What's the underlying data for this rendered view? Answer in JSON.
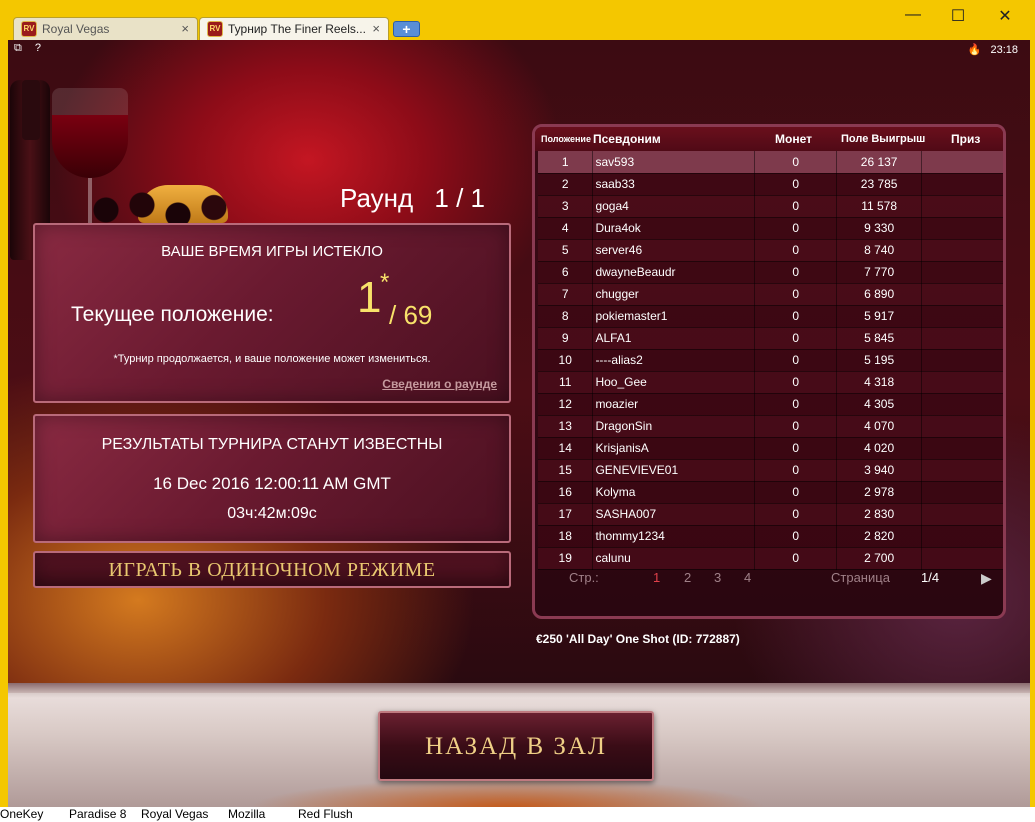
{
  "browser": {
    "tabs": [
      {
        "label": "Royal Vegas",
        "active": false
      },
      {
        "label": "Турнир The Finer Reels...",
        "active": true
      }
    ],
    "tab_icon": "RV",
    "tab_close": "×",
    "new_tab": "+",
    "window_controls": {
      "minimize": "—",
      "maximize": "☐",
      "close": "✕"
    }
  },
  "game_header": {
    "icons": [
      "copy-icon",
      "help-icon"
    ],
    "copy_glyph": "⧉",
    "help_glyph": "?",
    "time": "23:18",
    "flame_glyph": "🔥"
  },
  "round": {
    "label": "Раунд",
    "value": "1 / 1"
  },
  "status_panel": {
    "title": "ВАШЕ ВРЕМЯ ИГРЫ ИСТЕКЛО",
    "position_label": "Текущее положение:",
    "position": "1",
    "position_star": "*",
    "position_total": "/ 69",
    "note": "*Турнир продолжается, и ваше положение может измениться.",
    "details_link": "Сведения о раунде"
  },
  "results_panel": {
    "title": "РЕЗУЛЬТАТЫ ТУРНИРА СТАНУТ ИЗВЕСТНЫ",
    "date": "16 Dec 2016 12:00:11 AM GMT",
    "countdown": "03ч:42м:09с"
  },
  "play_single_button": "ИГРАТЬ В ОДИНОЧНОМ РЕЖИМЕ",
  "leaderboard": {
    "headers": {
      "position": "Положение",
      "nickname": "Псевдоним",
      "coins": "Монет",
      "winnings": "Поле Выигрыш",
      "prize": "Приз"
    },
    "rows": [
      {
        "pos": "1",
        "name": "sav593",
        "coins": "0",
        "win": "26 137",
        "prize": ""
      },
      {
        "pos": "2",
        "name": "saab33",
        "coins": "0",
        "win": "23 785",
        "prize": ""
      },
      {
        "pos": "3",
        "name": "goga4",
        "coins": "0",
        "win": "11 578",
        "prize": ""
      },
      {
        "pos": "4",
        "name": "Dura4ok",
        "coins": "0",
        "win": "9 330",
        "prize": ""
      },
      {
        "pos": "5",
        "name": "server46",
        "coins": "0",
        "win": "8 740",
        "prize": ""
      },
      {
        "pos": "6",
        "name": "dwayneBeaudr",
        "coins": "0",
        "win": "7 770",
        "prize": ""
      },
      {
        "pos": "7",
        "name": "chugger",
        "coins": "0",
        "win": "6 890",
        "prize": ""
      },
      {
        "pos": "8",
        "name": "pokiemaster1",
        "coins": "0",
        "win": "5 917",
        "prize": ""
      },
      {
        "pos": "9",
        "name": "ALFA1",
        "coins": "0",
        "win": "5 845",
        "prize": ""
      },
      {
        "pos": "10",
        "name": "----alias2",
        "coins": "0",
        "win": "5 195",
        "prize": ""
      },
      {
        "pos": "11",
        "name": "Hoo_Gee",
        "coins": "0",
        "win": "4 318",
        "prize": ""
      },
      {
        "pos": "12",
        "name": "moazier",
        "coins": "0",
        "win": "4 305",
        "prize": ""
      },
      {
        "pos": "13",
        "name": "DragonSin",
        "coins": "0",
        "win": "4 070",
        "prize": ""
      },
      {
        "pos": "14",
        "name": "KrisjanisA",
        "coins": "0",
        "win": "4 020",
        "prize": ""
      },
      {
        "pos": "15",
        "name": "GENEVIEVE01",
        "coins": "0",
        "win": "3 940",
        "prize": ""
      },
      {
        "pos": "16",
        "name": "Kolyma",
        "coins": "0",
        "win": "2 978",
        "prize": ""
      },
      {
        "pos": "17",
        "name": "SASHA007",
        "coins": "0",
        "win": "2 830",
        "prize": ""
      },
      {
        "pos": "18",
        "name": "thommy1234",
        "coins": "0",
        "win": "2 820",
        "prize": ""
      },
      {
        "pos": "19",
        "name": "calunu",
        "coins": "0",
        "win": "2 700",
        "prize": ""
      }
    ],
    "highlighted_row": 0,
    "pager": {
      "label": "Стр.:",
      "pages": [
        "1",
        "2",
        "3",
        "4"
      ],
      "active_page": "1",
      "page_label": "Страница",
      "page_value": "1/4",
      "next": "▶"
    }
  },
  "tournament_name": "€250 'All Day' One Shot (ID: 772887)",
  "back_button": "НАЗАД В ЗАЛ",
  "taskbar": [
    "OneKey",
    "Paradise 8",
    "Royal Vegas",
    "Mozilla",
    "Red Flush"
  ],
  "colors": {
    "accent_gold": "#f8e26a",
    "frame_yellow": "#f4c700",
    "highlight_row": "#7e3a4c",
    "active_page": "#e0404a"
  }
}
